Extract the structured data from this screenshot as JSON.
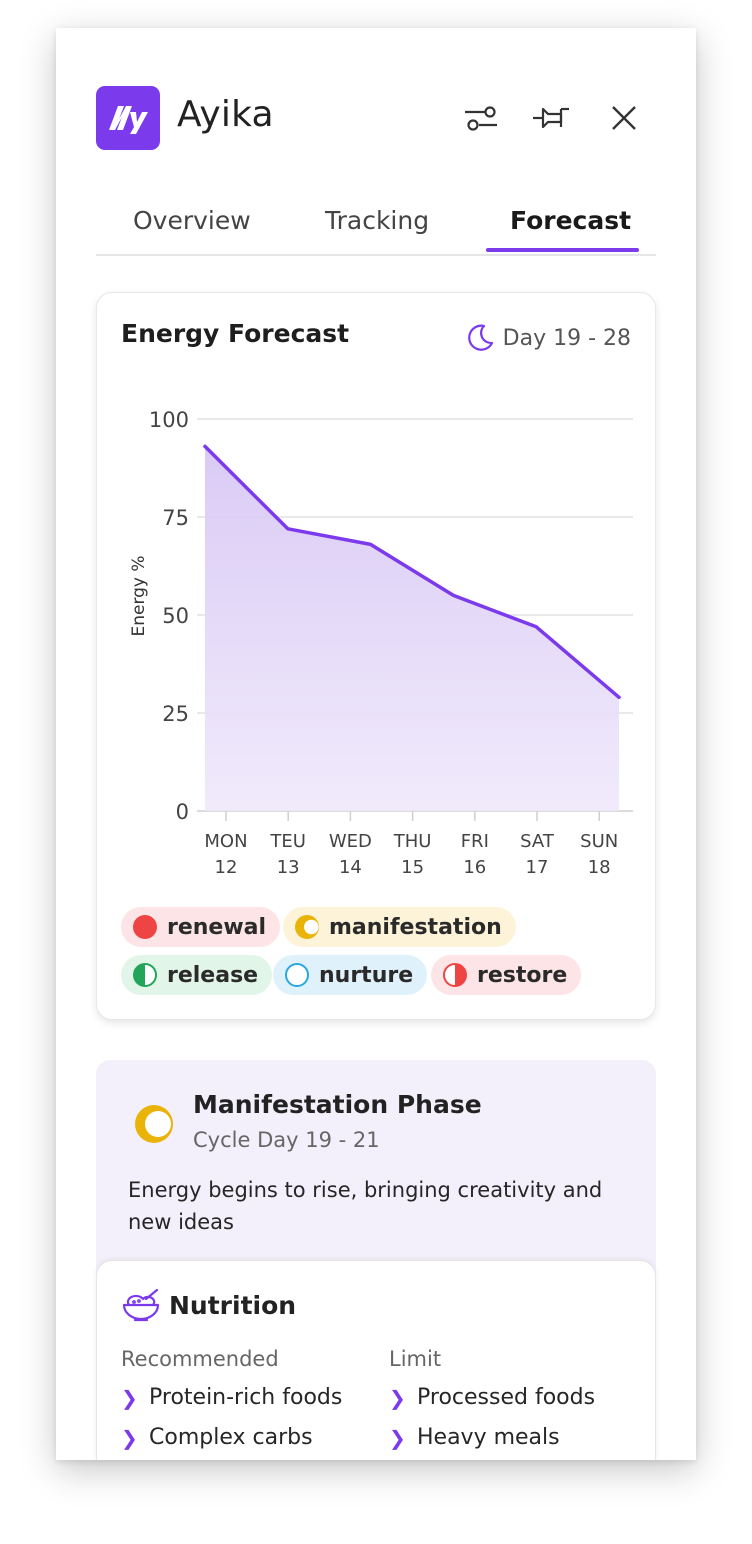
{
  "app": {
    "title": "Ayika"
  },
  "header_icons": [
    "sliders-icon",
    "pin-icon",
    "close-icon"
  ],
  "tabs": [
    {
      "label": "Overview",
      "active": false
    },
    {
      "label": "Tracking",
      "active": false
    },
    {
      "label": "Forecast",
      "active": true
    }
  ],
  "forecast": {
    "title": "Energy Forecast",
    "day_range": "Day 19 - 28"
  },
  "chart_data": {
    "type": "area",
    "ylabel": "Energy %",
    "ylim": [
      0,
      100
    ],
    "yticks": [
      "100",
      "75",
      "50",
      "25",
      "0"
    ],
    "categories": [
      {
        "day": "MON",
        "date": "12"
      },
      {
        "day": "TEU",
        "date": "13"
      },
      {
        "day": "WED",
        "date": "14"
      },
      {
        "day": "THU",
        "date": "15"
      },
      {
        "day": "FRI",
        "date": "16"
      },
      {
        "day": "SAT",
        "date": "17"
      },
      {
        "day": "SUN",
        "date": "18"
      }
    ],
    "values": [
      93,
      72,
      68,
      55,
      47,
      29
    ],
    "grid": true
  },
  "legend": [
    {
      "label": "renewal",
      "color": "#ef4444",
      "bg": "#fde4e6",
      "style": "filled"
    },
    {
      "label": "manifestation",
      "color": "#eab308",
      "bg": "#fdf3d8",
      "style": "crescent"
    },
    {
      "label": "release",
      "color": "#22a55a",
      "bg": "#e1f5e8",
      "style": "half"
    },
    {
      "label": "nurture",
      "color": "#2aa6e0",
      "bg": "#dff1fb",
      "style": "ring"
    },
    {
      "label": "restore",
      "color": "#ef4444",
      "bg": "#fde4e6",
      "style": "half-right"
    }
  ],
  "phase": {
    "title": "Manifestation Phase",
    "subtitle": "Cycle Day 19 - 21",
    "description": "Energy begins to rise, bringing creativity and new ideas"
  },
  "nutrition": {
    "title": "Nutrition",
    "recommended_label": "Recommended",
    "limit_label": "Limit",
    "recommended": [
      "Protein-rich foods",
      "Complex carbs"
    ],
    "limit": [
      "Processed foods",
      "Heavy meals"
    ]
  },
  "colors": {
    "accent": "#7c3aed",
    "fill": "#e6dcf8"
  }
}
